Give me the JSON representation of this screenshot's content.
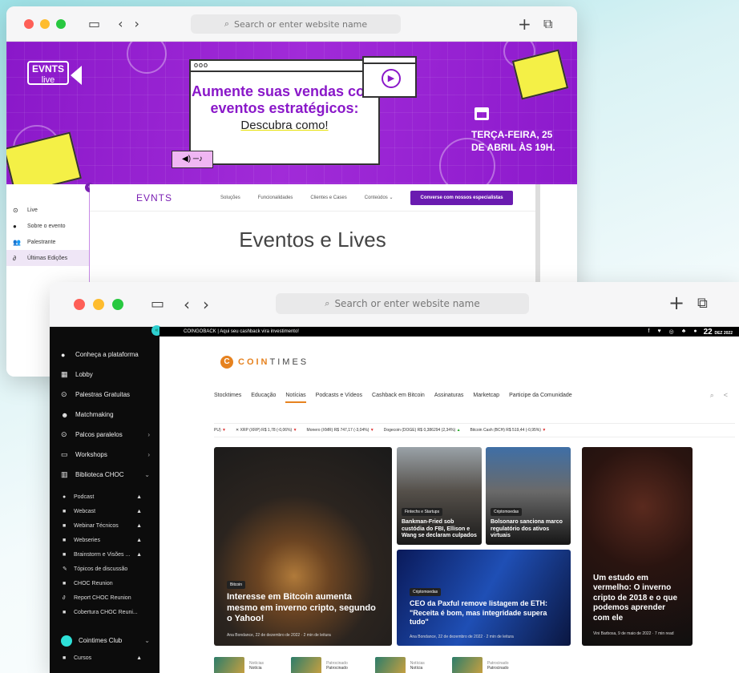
{
  "window1": {
    "address": "Search or enter website name",
    "hero": {
      "logo_top": "EVNTS",
      "logo_bottom": "live",
      "card_dots": "ooo",
      "headline": "Aumente suas vendas com eventos estratégicos:",
      "cta_text": "Descubra como!",
      "date_line1": "TERÇA-FEIRA, 25",
      "date_line2": "DE ABRIL ÀS 19H."
    },
    "sidebar": [
      {
        "label": "Live",
        "icon": "play-circle-icon"
      },
      {
        "label": "Sobre o evento",
        "icon": "info-icon"
      },
      {
        "label": "Palestrante",
        "icon": "people-icon"
      },
      {
        "label": "Últimas Edições",
        "icon": "link-icon"
      }
    ],
    "nav": {
      "logo": "EVNTS",
      "links": [
        "Soluções",
        "Funcionalidades",
        "Clientes e Cases",
        "Conteúdos ⌄"
      ],
      "cta": "Converse com nossos especialistas"
    },
    "page_title": "Eventos e Lives"
  },
  "window2": {
    "address": "Search or enter website name",
    "sidebar": {
      "items": [
        {
          "label": "Conheça a plataforma",
          "icon": "dot-icon"
        },
        {
          "label": "Lobby",
          "icon": "grid-icon"
        },
        {
          "label": "Palestras Gratuitas",
          "icon": "play-circle-icon"
        },
        {
          "label": "Matchmaking",
          "icon": "people-icon"
        },
        {
          "label": "Palcos paralelos",
          "icon": "play-circle-icon",
          "chevron": "›"
        },
        {
          "label": "Workshops",
          "icon": "monitor-icon",
          "chevron": "›"
        },
        {
          "label": "Biblioteca CHOC",
          "icon": "library-icon",
          "chevron": "⌄"
        }
      ],
      "subitems": [
        {
          "label": "Podcast",
          "icon": "mic-icon",
          "locked": true
        },
        {
          "label": "Webcast",
          "icon": "video-icon",
          "locked": true
        },
        {
          "label": "Webinar Técnicos",
          "icon": "video-icon",
          "locked": true
        },
        {
          "label": "Webseries",
          "icon": "video-icon",
          "locked": true
        },
        {
          "label": "Brainstorm e Visões ...",
          "icon": "video-icon",
          "locked": true
        },
        {
          "label": "Tópicos de discussão",
          "icon": "pin-icon",
          "locked": false
        },
        {
          "label": "CHOC Reunion",
          "icon": "video-icon",
          "locked": false
        },
        {
          "label": "Report CHOC Reunion",
          "icon": "link-icon",
          "locked": false
        },
        {
          "label": "Cobertura CHOC Reuni...",
          "icon": "video-icon",
          "locked": false
        }
      ],
      "club": {
        "label": "Cointimes Club",
        "chevron": "⌄"
      },
      "club_sub": {
        "label": "Cursos",
        "locked": true
      }
    },
    "topbar": {
      "promo": "COINGOBACK | Aqui seu cashback vira investimento!",
      "social": [
        "f",
        "♥",
        "◎",
        "♣",
        "●"
      ],
      "date_day": "22",
      "date_month": "DEZ 2022"
    },
    "logo": {
      "coin": "COIN",
      "times": "TIMES"
    },
    "nav": [
      "Stocktimes",
      "Educação",
      "Notícias",
      "Podcasts e Vídeos",
      "Cashback em Bitcoin",
      "Assinaturas",
      "Marketcap",
      "Participe da Comunidade"
    ],
    "ticker": [
      {
        "label": "PU)",
        "dir": "▼",
        "cls": "neg"
      },
      {
        "label": "✕  XRP (XRP)  R$ 1,78 (-0,06%)",
        "dir": "▼",
        "cls": "neg"
      },
      {
        "label": "Monero (XMR)  R$ 747,17 (-3,04%)",
        "dir": "▼",
        "cls": "neg"
      },
      {
        "label": "Dogecoin (DOGE)  R$ 0,386294 (2,34%)",
        "dir": "▲",
        "cls": "pos"
      },
      {
        "label": "Bitcoin Cash (BCH)  R$ 519,44 (-0,95%)",
        "dir": "▼",
        "cls": "neg"
      }
    ],
    "cards": {
      "big": {
        "tag": "Bitcoin",
        "title": "Interesse em Bitcoin aumenta mesmo em inverno cripto, segundo o Yahoo!",
        "meta": "Ana Bondance, 22 de dezembro de 2022 · 2 min de leitura"
      },
      "s1": {
        "tag": "Fintechs e Startups",
        "title": "Bankman-Fried sob custódia do FBI, Ellison e Wang se declaram culpados"
      },
      "s2": {
        "tag": "Criptomoedas",
        "title": "Bolsonaro sanciona marco regulatório dos ativos virtuais"
      },
      "mid": {
        "tag": "Criptomoedas",
        "title": "CEO da Paxful remove listagem de ETH: \"Receita é bom, mas integridade supera tudo\"",
        "meta": "Ana Bondance, 22 de dezembro de 2022 · 2 min de leitura"
      },
      "right": {
        "title": "Um estudo em vermelho: O inverno cripto de 2018 e o que podemos aprender com ele",
        "meta": "Vini Barbosa, 9 de maio de 2022 · 7 min read"
      }
    },
    "bottom": [
      {
        "kicker": "Notícias",
        "label": "Notícia"
      },
      {
        "kicker": "Patrocinado",
        "label": "Patrocinado"
      },
      {
        "kicker": "Notícias",
        "label": "Notícia"
      },
      {
        "kicker": "Patrocinado",
        "label": "Patrocinado"
      }
    ]
  }
}
